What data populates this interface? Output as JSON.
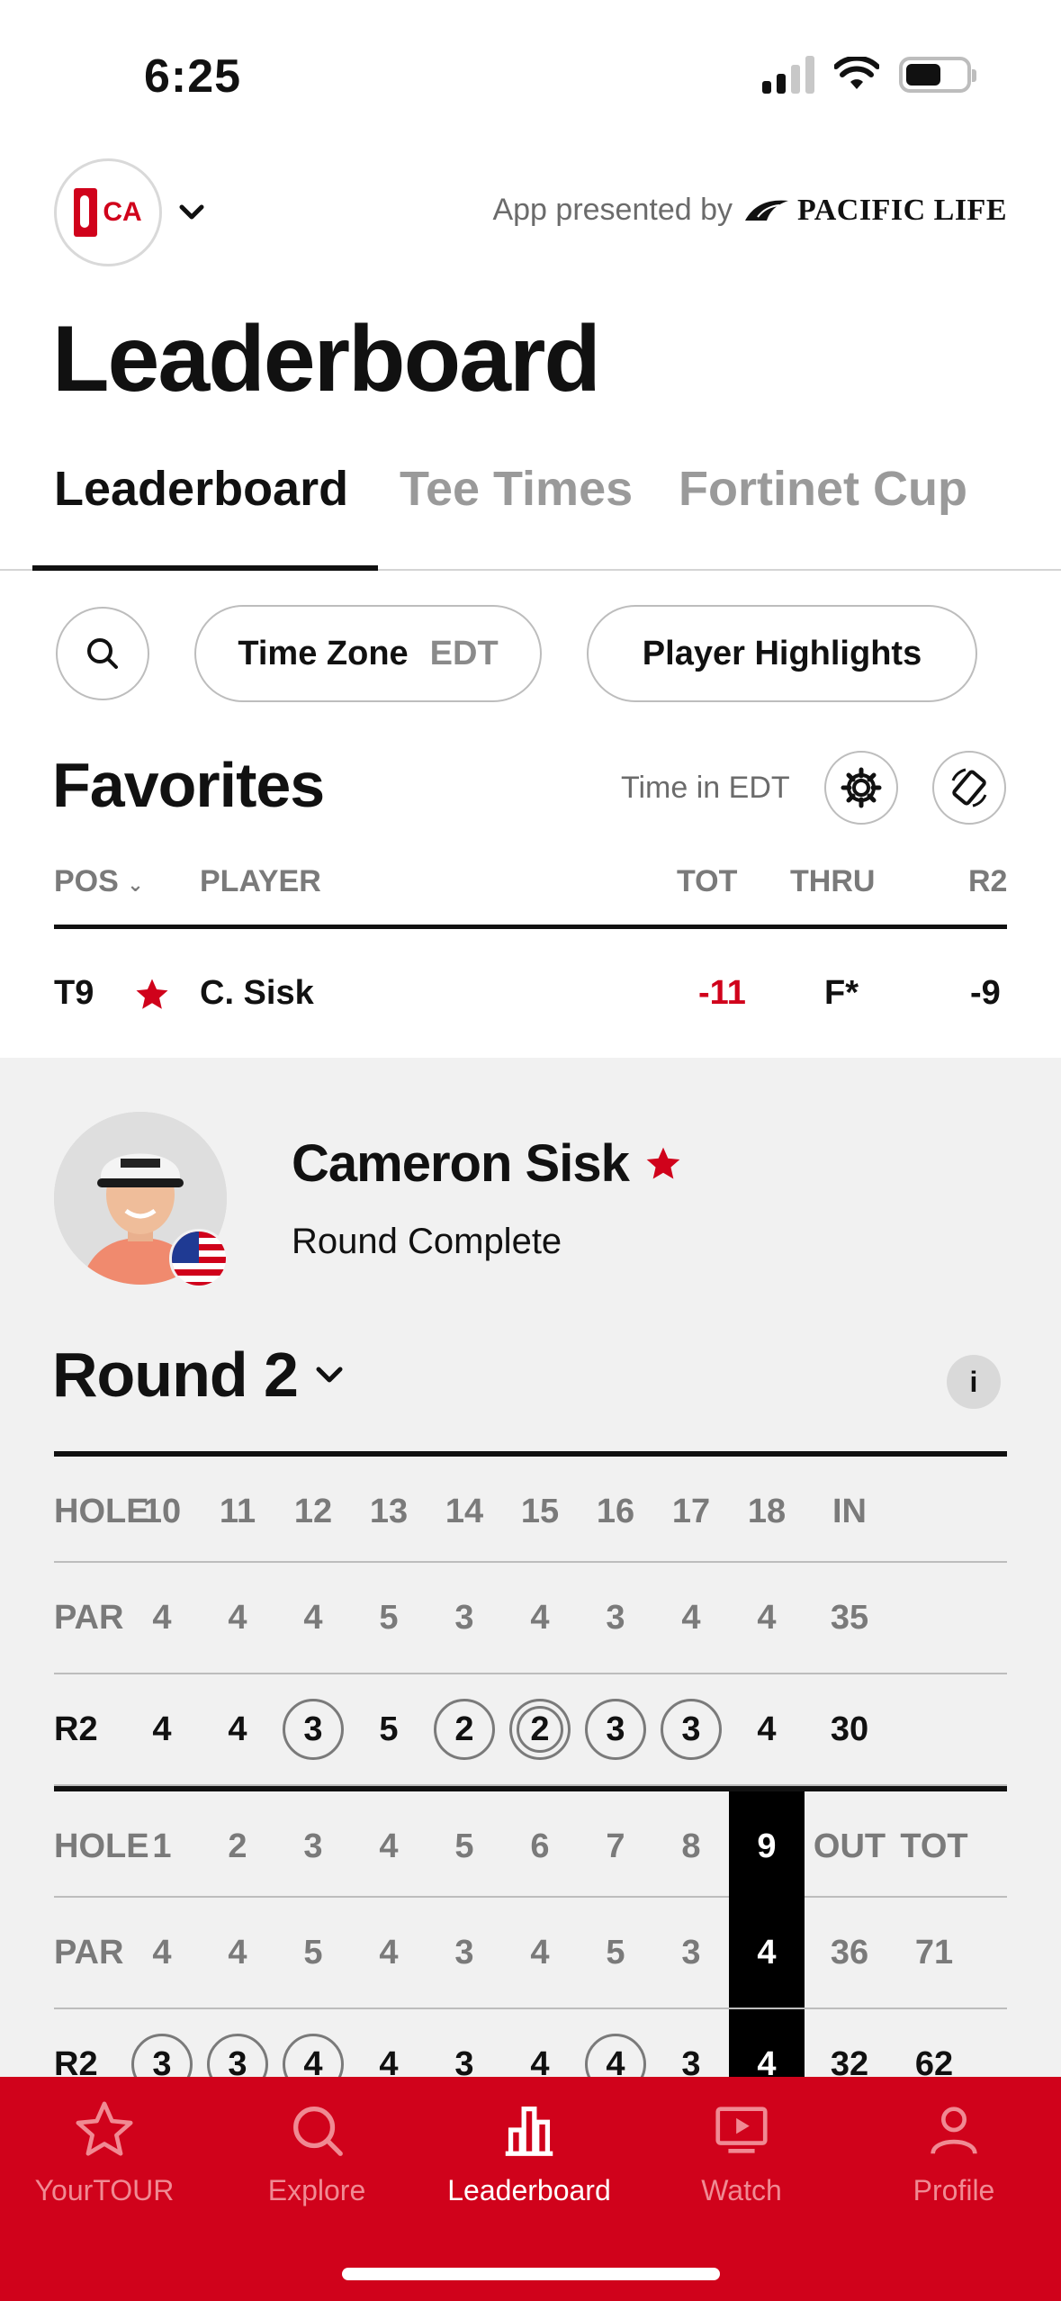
{
  "status_bar": {
    "time": "6:25"
  },
  "header": {
    "logo_text": "CA",
    "presented_by": "App presented by",
    "sponsor": "PACIFIC LIFE",
    "title": "Leaderboard"
  },
  "tabs": [
    {
      "label": "Leaderboard",
      "active": true
    },
    {
      "label": "Tee Times",
      "active": false
    },
    {
      "label": "Fortinet Cup",
      "active": false
    }
  ],
  "filters": {
    "time_zone_label": "Time Zone",
    "time_zone_value": "EDT",
    "highlights_label": "Player Highlights"
  },
  "favorites": {
    "title": "Favorites",
    "time_note": "Time in EDT",
    "columns": {
      "pos": "POS",
      "player": "PLAYER",
      "tot": "TOT",
      "thru": "THRU",
      "round": "R2"
    },
    "row": {
      "pos": "T9",
      "player": "C. Sisk",
      "tot": "-11",
      "thru": "F*",
      "round": "-9"
    }
  },
  "player": {
    "name": "Cameron Sisk",
    "status": "Round Complete",
    "round_title": "Round 2",
    "info": "i"
  },
  "scorecard": {
    "back": {
      "hole_label": "HOLE",
      "holes": [
        "10",
        "11",
        "12",
        "13",
        "14",
        "15",
        "16",
        "17",
        "18",
        "IN"
      ],
      "par_label": "PAR",
      "par": [
        "4",
        "4",
        "4",
        "5",
        "3",
        "4",
        "3",
        "4",
        "4",
        "35"
      ],
      "score_label": "R2",
      "scores": [
        "4",
        "4",
        "3",
        "5",
        "2",
        "2",
        "3",
        "3",
        "4",
        "30"
      ]
    },
    "front": {
      "hole_label": "HOLE",
      "holes": [
        "1",
        "2",
        "3",
        "4",
        "5",
        "6",
        "7",
        "8",
        "9",
        "OUT",
        "TOT"
      ],
      "par_label": "PAR",
      "par": [
        "4",
        "4",
        "5",
        "4",
        "3",
        "4",
        "5",
        "3",
        "4",
        "36",
        "71"
      ],
      "score_label": "R2",
      "scores": [
        "3",
        "3",
        "4",
        "4",
        "3",
        "4",
        "4",
        "3",
        "4",
        "32",
        "62"
      ]
    }
  },
  "bottom_nav": [
    {
      "label": "YourTOUR",
      "icon": "star-icon"
    },
    {
      "label": "Explore",
      "icon": "search-icon"
    },
    {
      "label": "Leaderboard",
      "icon": "bar-chart-icon",
      "active": true
    },
    {
      "label": "Watch",
      "icon": "play-icon"
    },
    {
      "label": "Profile",
      "icon": "person-icon"
    }
  ],
  "colors": {
    "brand_red": "#d0021b",
    "text": "#111111",
    "muted": "#7a7a7a",
    "panel_bg": "#f1f1f1"
  }
}
